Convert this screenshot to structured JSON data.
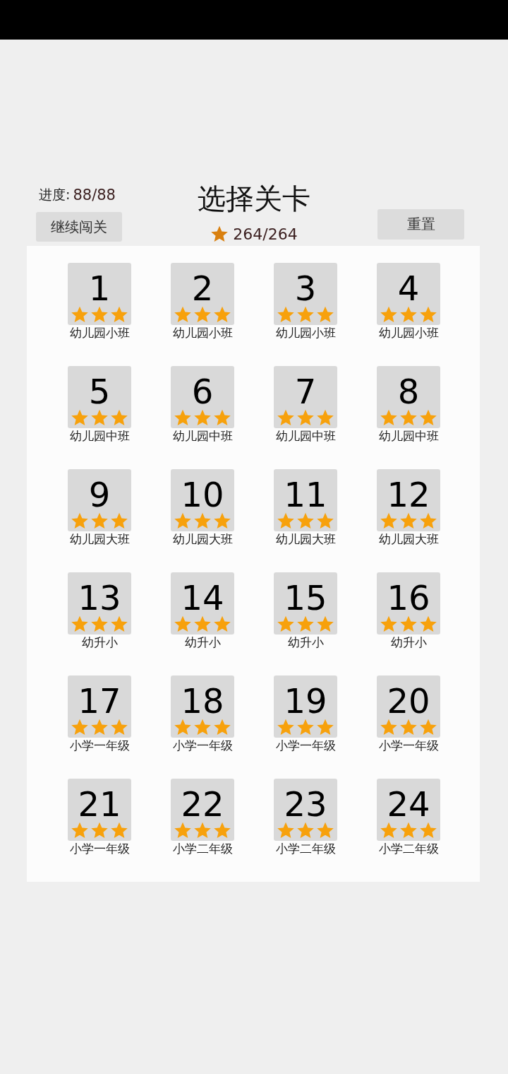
{
  "title": "选择关卡",
  "progress": {
    "label": "进度:",
    "value": "88/88"
  },
  "total_stars": "264/264",
  "buttons": {
    "continue": "继续闯关",
    "reset": "重置"
  },
  "levels": [
    {
      "number": "1",
      "stars": 3,
      "label": "幼儿园小班"
    },
    {
      "number": "2",
      "stars": 3,
      "label": "幼儿园小班"
    },
    {
      "number": "3",
      "stars": 3,
      "label": "幼儿园小班"
    },
    {
      "number": "4",
      "stars": 3,
      "label": "幼儿园小班"
    },
    {
      "number": "5",
      "stars": 3,
      "label": "幼儿园中班"
    },
    {
      "number": "6",
      "stars": 3,
      "label": "幼儿园中班"
    },
    {
      "number": "7",
      "stars": 3,
      "label": "幼儿园中班"
    },
    {
      "number": "8",
      "stars": 3,
      "label": "幼儿园中班"
    },
    {
      "number": "9",
      "stars": 3,
      "label": "幼儿园大班"
    },
    {
      "number": "10",
      "stars": 3,
      "label": "幼儿园大班"
    },
    {
      "number": "11",
      "stars": 3,
      "label": "幼儿园大班"
    },
    {
      "number": "12",
      "stars": 3,
      "label": "幼儿园大班"
    },
    {
      "number": "13",
      "stars": 3,
      "label": "幼升小"
    },
    {
      "number": "14",
      "stars": 3,
      "label": "幼升小"
    },
    {
      "number": "15",
      "stars": 3,
      "label": "幼升小"
    },
    {
      "number": "16",
      "stars": 3,
      "label": "幼升小"
    },
    {
      "number": "17",
      "stars": 3,
      "label": "小学一年级"
    },
    {
      "number": "18",
      "stars": 3,
      "label": "小学一年级"
    },
    {
      "number": "19",
      "stars": 3,
      "label": "小学一年级"
    },
    {
      "number": "20",
      "stars": 3,
      "label": "小学一年级"
    },
    {
      "number": "21",
      "stars": 3,
      "label": "小学一年级"
    },
    {
      "number": "22",
      "stars": 3,
      "label": "小学二年级"
    },
    {
      "number": "23",
      "stars": 3,
      "label": "小学二年级"
    },
    {
      "number": "24",
      "stars": 3,
      "label": "小学二年级"
    }
  ]
}
